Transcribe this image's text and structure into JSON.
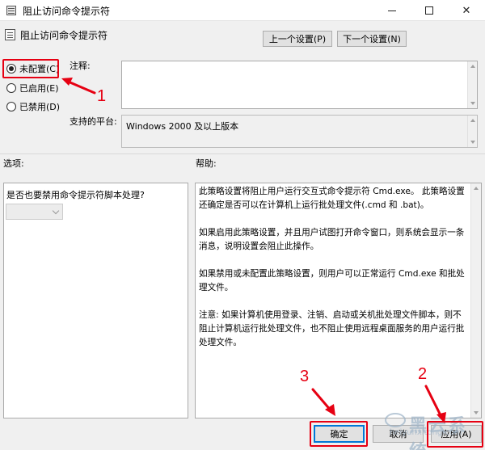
{
  "window": {
    "title": "阻止访问命令提示符",
    "icon": "policy-icon"
  },
  "policy": {
    "title": "阻止访问命令提示符"
  },
  "nav": {
    "prev_label": "上一个设置(P)",
    "next_label": "下一个设置(N)"
  },
  "state": {
    "options": [
      {
        "label": "未配置(C)",
        "checked": true
      },
      {
        "label": "已启用(E)",
        "checked": false
      },
      {
        "label": "已禁用(D)",
        "checked": false
      }
    ]
  },
  "comment": {
    "label": "注释:",
    "value": ""
  },
  "platform": {
    "label": "支持的平台:",
    "value": "Windows 2000 及以上版本"
  },
  "options_section": {
    "label": "选项:",
    "question": "是否也要禁用命令提示符脚本处理?",
    "select_value": ""
  },
  "help_section": {
    "label": "帮助:",
    "paragraphs": [
      "此策略设置将阻止用户运行交互式命令提示符 Cmd.exe。 此策略设置还确定是否可以在计算机上运行批处理文件(.cmd 和 .bat)。",
      "如果启用此策略设置，并且用户试图打开命令窗口，则系统会显示一条消息，说明设置会阻止此操作。",
      "如果禁用或未配置此策略设置，则用户可以正常运行 Cmd.exe 和批处理文件。",
      "注意: 如果计算机使用登录、注销、启动或关机批处理文件脚本，则不阻止计算机运行批处理文件，也不阻止使用远程桌面服务的用户运行批处理文件。"
    ]
  },
  "footer": {
    "ok_label": "确定",
    "cancel_label": "取消",
    "apply_label": "应用(A)"
  },
  "annotations": {
    "color": "#e60012",
    "labels": [
      "1",
      "2",
      "3"
    ]
  },
  "watermark": {
    "brand": "黑云系统",
    "url": "heiyunxitong.com"
  }
}
